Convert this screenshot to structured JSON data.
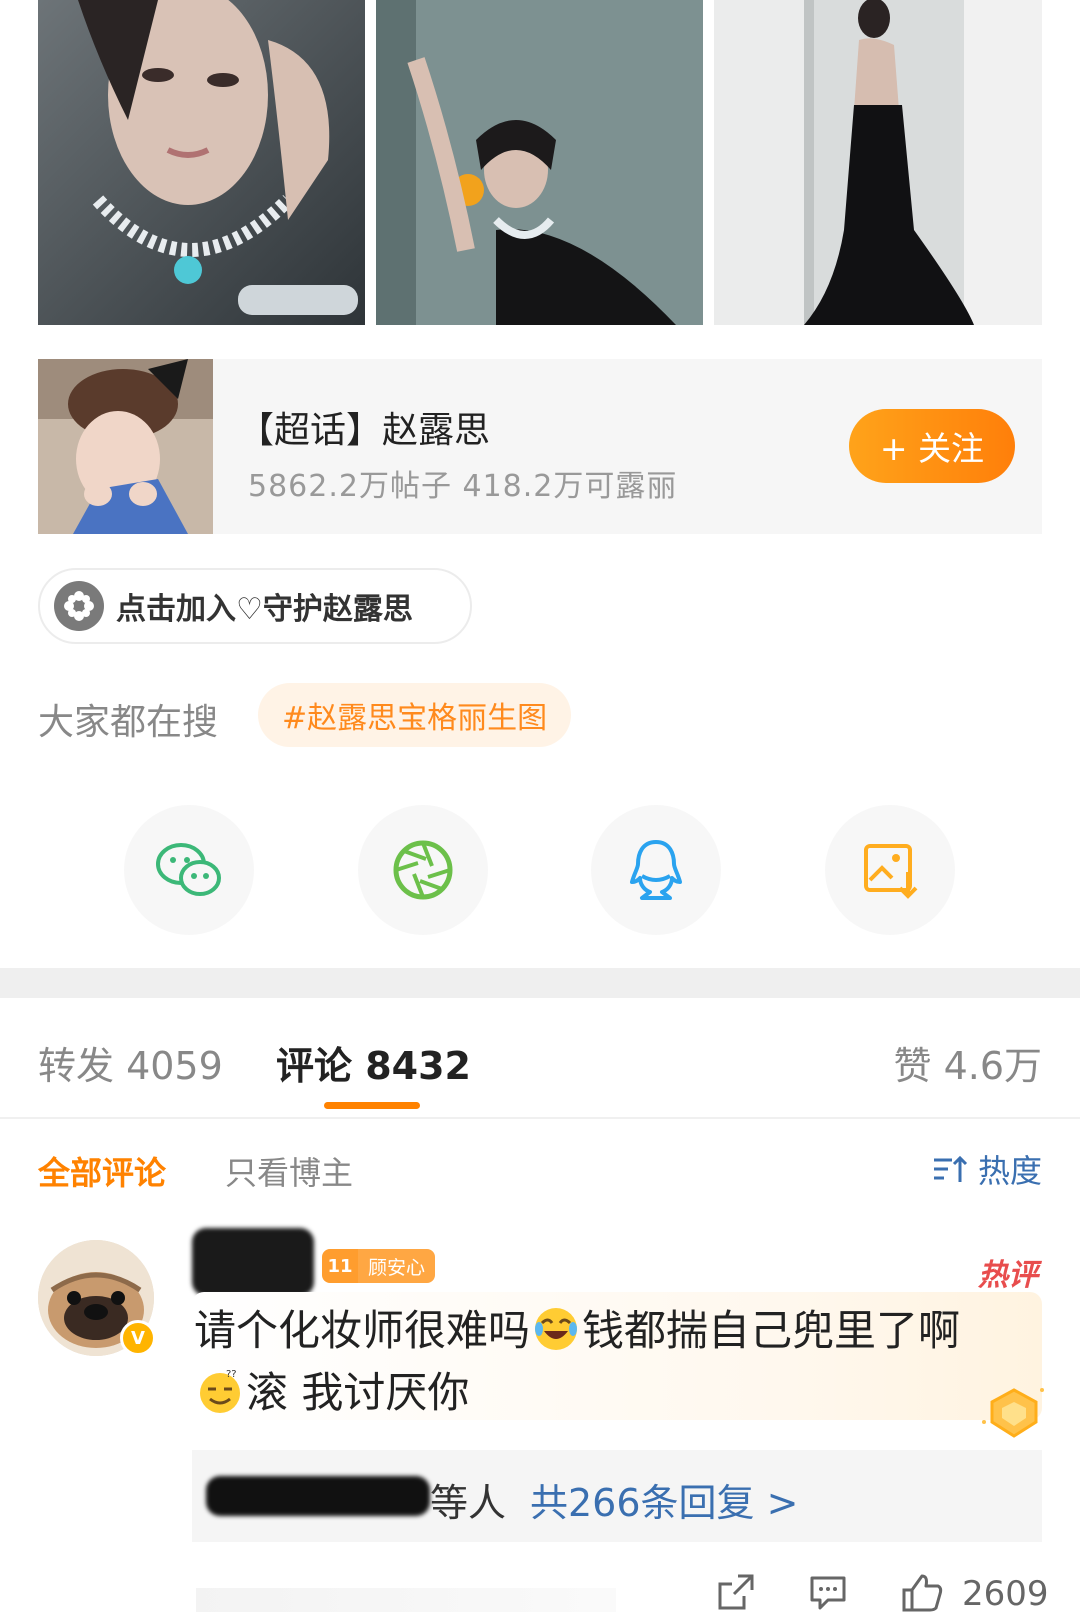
{
  "topic": {
    "title": "【超话】赵露思",
    "stats": "5862.2万帖子 418.2万可露丽",
    "follow_label": "+ 关注"
  },
  "join": {
    "label": "点击加入♡守护赵露思"
  },
  "search": {
    "label": "大家都在搜",
    "tag": "#赵露思宝格丽生图"
  },
  "share": {
    "icons": [
      "wechat-icon",
      "moments-icon",
      "qq-icon",
      "save-image-icon"
    ],
    "colors": {
      "wechat": "#3cb878",
      "moments": "#6cc04a",
      "qq": "#2aa3ef",
      "save": "#ffad1f"
    }
  },
  "tabs": {
    "repost": "转发 4059",
    "comments": "评论 8432",
    "likes": "赞 4.6万"
  },
  "filters": {
    "all": "全部评论",
    "owner_only": "只看博主",
    "sort": "热度"
  },
  "comment": {
    "fan_level": "11",
    "fan_badge": "顾安心",
    "hot_label": "热评",
    "text_part1": "请个化妆师很难吗",
    "text_part2": "钱都揣自己兜里了啊",
    "text_part3": "滚 我讨厌你",
    "verified_mark": "V",
    "reply_who": "等人",
    "reply_count": "共266条回复 >",
    "like_count": "2609"
  },
  "colors": {
    "accent": "#ff8200",
    "link": "#3a6fb0",
    "hot": "#e84d4d"
  }
}
